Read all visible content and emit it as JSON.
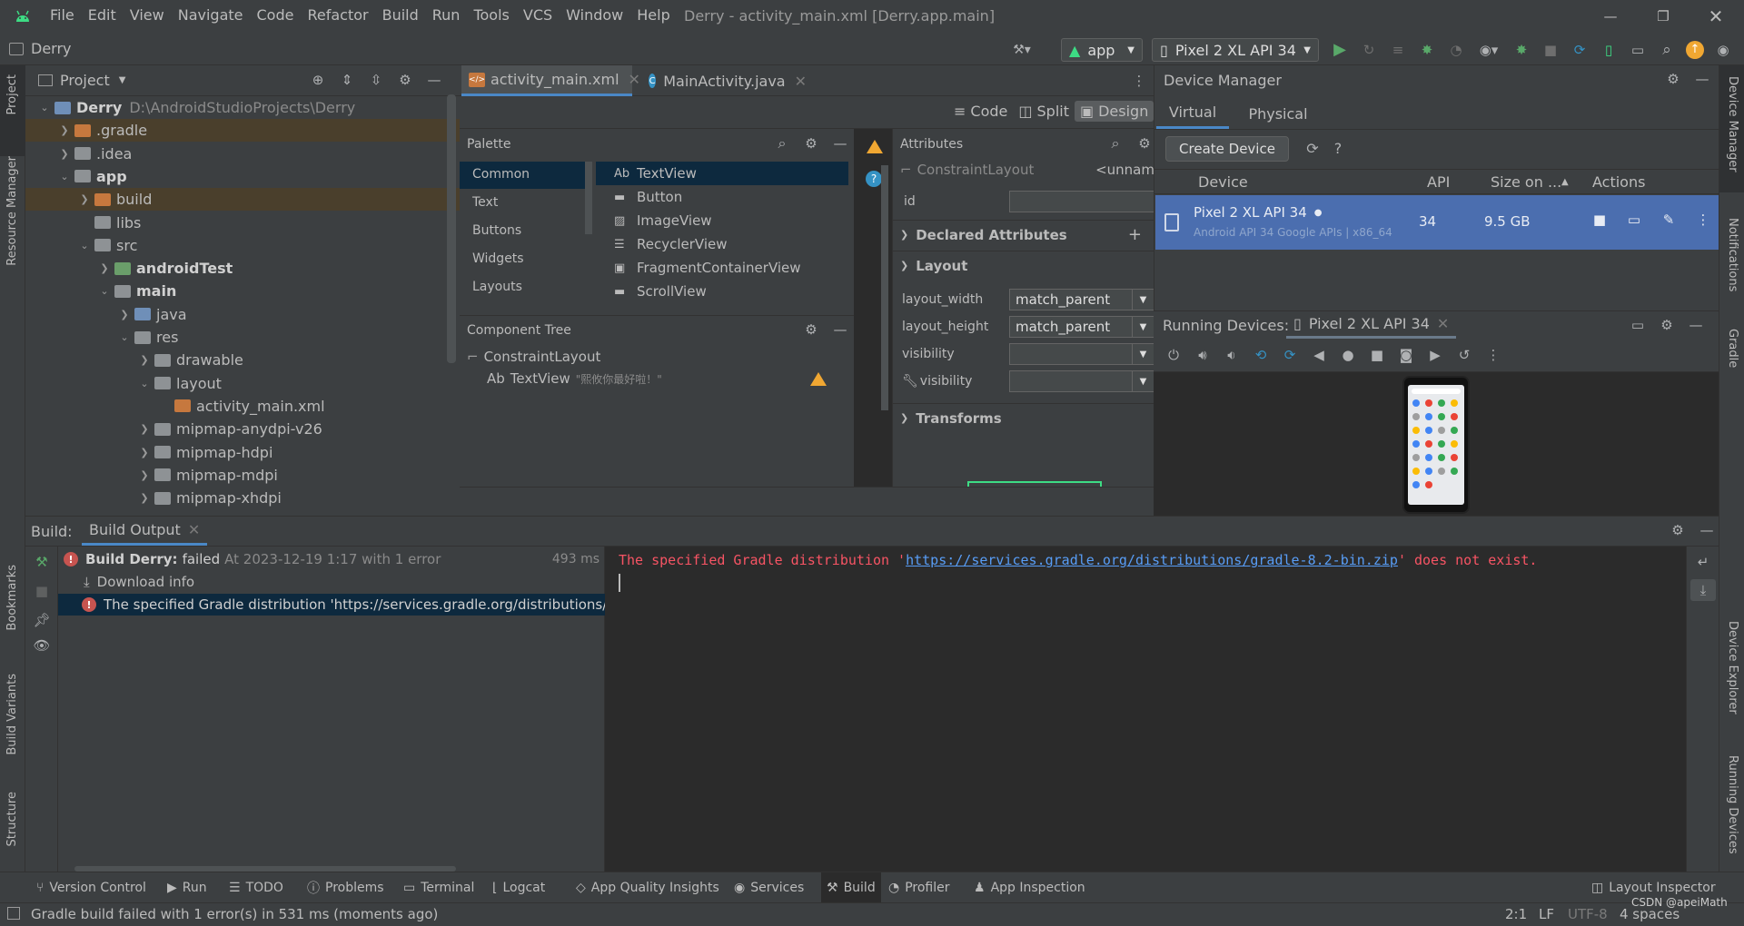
{
  "window": {
    "title": "Derry - activity_main.xml [Derry.app.main]",
    "menu": [
      "File",
      "Edit",
      "View",
      "Navigate",
      "Code",
      "Refactor",
      "Build",
      "Run",
      "Tools",
      "VCS",
      "Window",
      "Help"
    ]
  },
  "toolbar": {
    "project_name": "Derry",
    "run_config": "app",
    "device": "Pixel 2 XL API 34"
  },
  "left_stripe": [
    "Project",
    "Resource Manager",
    "Bookmarks",
    "Build Variants",
    "Structure"
  ],
  "right_stripe": [
    "Device Manager",
    "Notifications",
    "Gradle",
    "Device Explorer",
    "Running Devices"
  ],
  "project_panel": {
    "title": "Project",
    "root_path": "D:\\AndroidStudioProjects\\Derry",
    "rows": [
      {
        "label": "Derry",
        "indent": 0,
        "arrow": "down",
        "icon": "folder-blue",
        "bold": true,
        "hl": false
      },
      {
        "label": ".gradle",
        "indent": 1,
        "arrow": "right",
        "icon": "folder-orange",
        "bold": false,
        "hl": true
      },
      {
        "label": ".idea",
        "indent": 1,
        "arrow": "right",
        "icon": "folder-gray",
        "bold": false,
        "hl": false
      },
      {
        "label": "app",
        "indent": 1,
        "arrow": "down",
        "icon": "folder-module",
        "bold": true,
        "hl": false
      },
      {
        "label": "build",
        "indent": 2,
        "arrow": "right",
        "icon": "folder-orange",
        "bold": false,
        "hl": true
      },
      {
        "label": "libs",
        "indent": 2,
        "arrow": "",
        "icon": "folder-gray",
        "bold": false,
        "hl": false
      },
      {
        "label": "src",
        "indent": 2,
        "arrow": "down",
        "icon": "folder-gray",
        "bold": false,
        "hl": false
      },
      {
        "label": "androidTest",
        "indent": 3,
        "arrow": "right",
        "icon": "folder-test",
        "bold": true,
        "hl": false
      },
      {
        "label": "main",
        "indent": 3,
        "arrow": "down",
        "icon": "folder-gray",
        "bold": true,
        "hl": false
      },
      {
        "label": "java",
        "indent": 4,
        "arrow": "right",
        "icon": "folder-blue",
        "bold": false,
        "hl": false
      },
      {
        "label": "res",
        "indent": 4,
        "arrow": "down",
        "icon": "folder-res",
        "bold": false,
        "hl": false
      },
      {
        "label": "drawable",
        "indent": 5,
        "arrow": "right",
        "icon": "folder-gray",
        "bold": false,
        "hl": false
      },
      {
        "label": "layout",
        "indent": 5,
        "arrow": "down",
        "icon": "folder-gray",
        "bold": false,
        "hl": false
      },
      {
        "label": "activity_main.xml",
        "indent": 6,
        "arrow": "",
        "icon": "xml-file",
        "bold": false,
        "hl": false
      },
      {
        "label": "mipmap-anydpi-v26",
        "indent": 5,
        "arrow": "right",
        "icon": "folder-gray",
        "bold": false,
        "hl": false
      },
      {
        "label": "mipmap-hdpi",
        "indent": 5,
        "arrow": "right",
        "icon": "folder-gray",
        "bold": false,
        "hl": false
      },
      {
        "label": "mipmap-mdpi",
        "indent": 5,
        "arrow": "right",
        "icon": "folder-gray",
        "bold": false,
        "hl": false
      },
      {
        "label": "mipmap-xhdpi",
        "indent": 5,
        "arrow": "right",
        "icon": "folder-gray",
        "bold": false,
        "hl": false
      }
    ]
  },
  "editor": {
    "tabs": [
      {
        "label": "activity_main.xml",
        "active": true
      },
      {
        "label": "MainActivity.java",
        "active": false
      }
    ],
    "view_modes": [
      "Code",
      "Split",
      "Design"
    ],
    "active_mode": "Design"
  },
  "palette": {
    "title": "Palette",
    "categories": [
      "Common",
      "Text",
      "Buttons",
      "Widgets",
      "Layouts"
    ],
    "items": [
      "TextView",
      "Button",
      "ImageView",
      "RecyclerView",
      "FragmentContainerView",
      "ScrollView"
    ],
    "textview_prefix": "Ab"
  },
  "component_tree": {
    "title": "Component Tree",
    "root": "ConstraintLayout",
    "child_prefix": "Ab",
    "child": "TextView",
    "child_text": "\"熙攸你最好啦！\""
  },
  "attributes": {
    "title": "Attributes",
    "component": "ConstraintLayout",
    "component_id": "<unnam",
    "id_label": "id",
    "declared": "Declared Attributes",
    "layout": "Layout",
    "rows": [
      {
        "label": "layout_width",
        "value": "match_parent"
      },
      {
        "label": "layout_height",
        "value": "match_parent"
      },
      {
        "label": "visibility",
        "value": ""
      },
      {
        "label": "visibility",
        "value": ""
      }
    ],
    "transforms": "Transforms"
  },
  "device_manager": {
    "title": "Device Manager",
    "tabs": [
      "Virtual",
      "Physical"
    ],
    "create_button": "Create Device",
    "help": "?",
    "columns": [
      "Device",
      "API",
      "Size on ...",
      "Actions"
    ],
    "device": {
      "name": "Pixel 2 XL API 34",
      "subtitle": "Android API 34 Google APIs | x86_64",
      "api": "34",
      "size": "9.5 GB"
    },
    "running_label": "Running Devices:",
    "running_tab": "Pixel 2 XL API 34"
  },
  "build": {
    "label": "Build:",
    "tab": "Build Output",
    "tree": [
      {
        "text": "Build Derry:",
        "status": "failed",
        "detail": "At 2023-12-19 1:17 with 1 error",
        "time": "493 ms"
      },
      {
        "text": "Download info"
      },
      {
        "text": "The specified Gradle distribution 'https://services.gradle.org/distributions/g"
      }
    ],
    "console": {
      "prefix": "The specified Gradle distribution '",
      "link": "https://services.gradle.org/distributions/gradle-8.2-bin.zip",
      "suffix": "' does not exist."
    }
  },
  "bottom_tools": [
    "Version Control",
    "Run",
    "TODO",
    "Problems",
    "Terminal",
    "Logcat",
    "App Quality Insights",
    "Services",
    "Build",
    "Profiler",
    "App Inspection"
  ],
  "layout_inspector": "Layout Inspector",
  "status": {
    "message": "Gradle build failed with 1 error(s) in 531 ms (moments ago)",
    "position": "2:1",
    "line_sep": "LF",
    "encoding": "UTF-8",
    "indent": "4 spaces",
    "watermark": "CSDN @apeiMath"
  },
  "colors": {
    "error_red": "#f75464",
    "link_blue": "#589df6",
    "selection": "#4b6eaf",
    "accent": "#3592c4",
    "folder_orange": "#c6783e"
  }
}
